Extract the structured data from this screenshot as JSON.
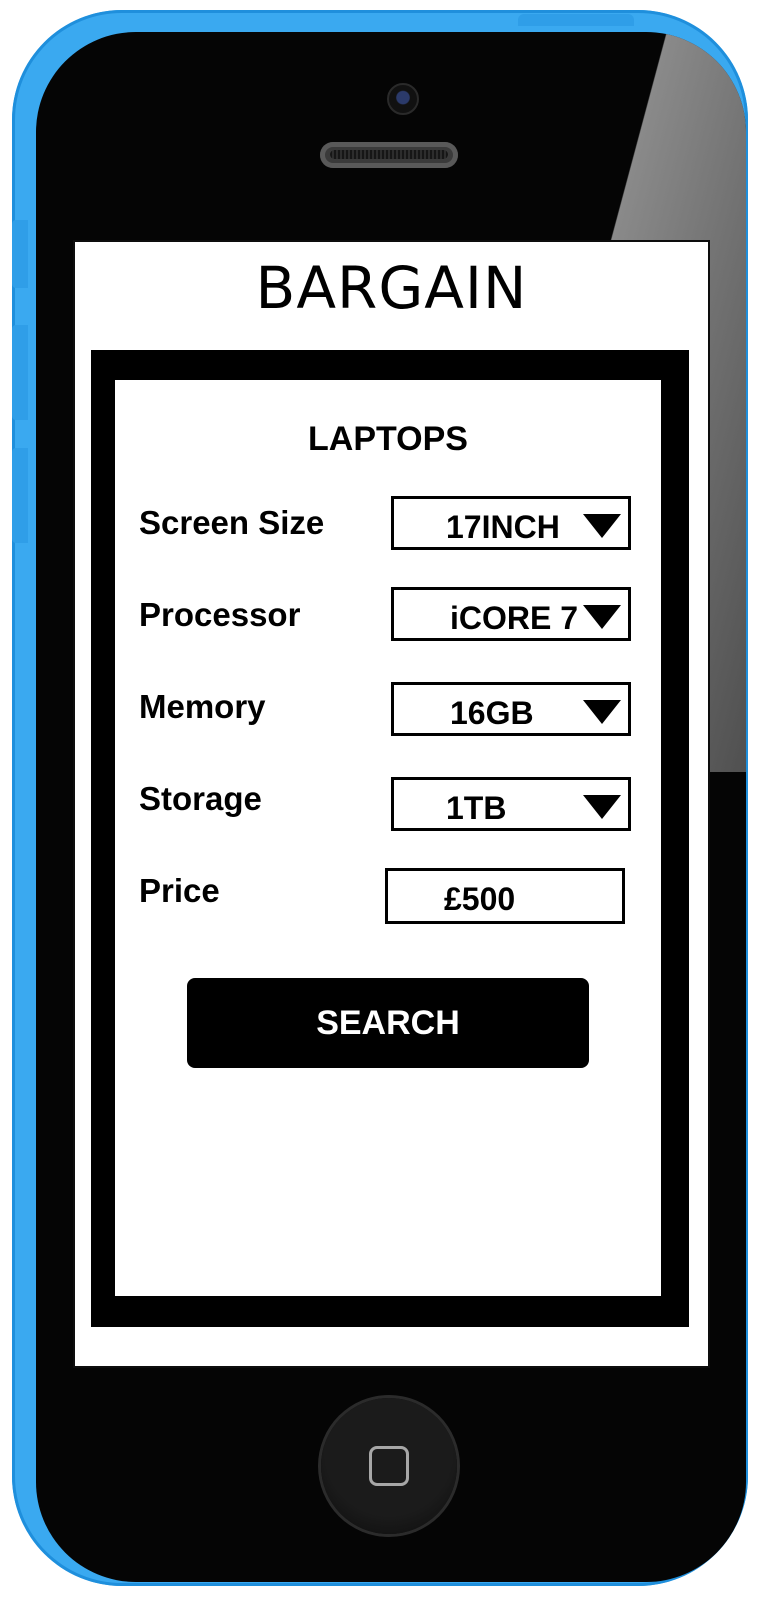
{
  "app": {
    "title": "BARGAIN"
  },
  "panel": {
    "heading": "LAPTOPS",
    "fields": [
      {
        "label": "Screen Size",
        "value": "17INCH"
      },
      {
        "label": "Processor",
        "value": "iCORE 7"
      },
      {
        "label": "Memory",
        "value": "16GB"
      },
      {
        "label": "Storage",
        "value": "1TB"
      }
    ],
    "price": {
      "label": "Price",
      "value": "£500"
    },
    "search_label": "SEARCH"
  },
  "colors": {
    "phone_body": "#3aa9f0",
    "screen_bg": "#ffffff",
    "panel_border": "#000000",
    "button_bg": "#000000",
    "button_text": "#ffffff"
  },
  "icons": {
    "dropdown": "chevron-down-icon",
    "home": "home-button-icon"
  }
}
